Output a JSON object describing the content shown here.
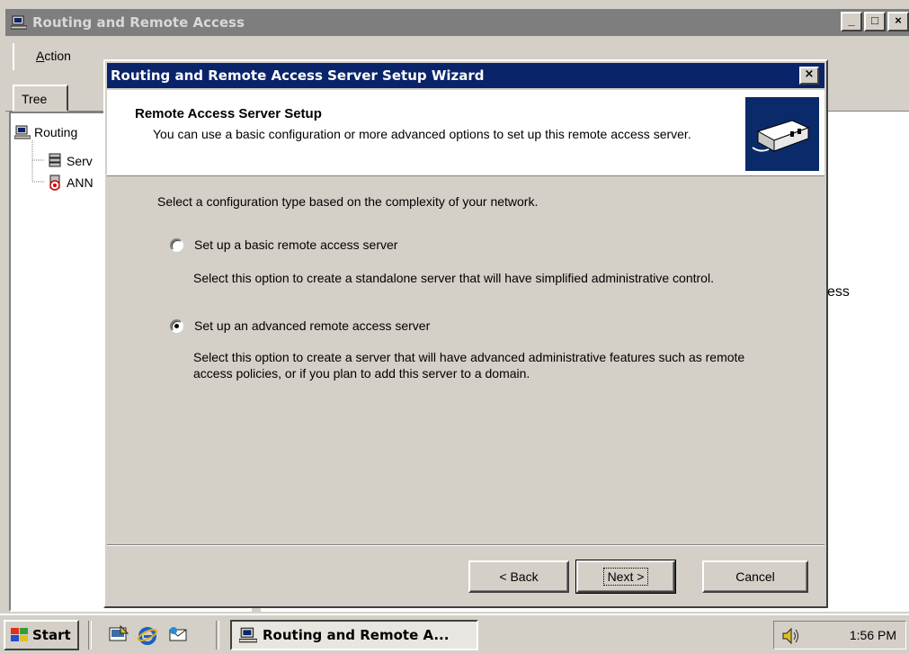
{
  "main_window": {
    "title": "Routing and Remote Access",
    "min_glyph": "_",
    "max_glyph": "□",
    "close_glyph": "×"
  },
  "menu": {
    "action_underlined": "A",
    "action_rest": "ction"
  },
  "tabs": {
    "tree": "Tree"
  },
  "tree": {
    "root": "Routing",
    "server_status": "Serv",
    "server_node": "ANN"
  },
  "right_pane": {
    "partial_text": "ess"
  },
  "wizard": {
    "title": "Routing and Remote Access Server Setup Wizard",
    "close_glyph": "×",
    "header_title": "Remote Access Server Setup",
    "header_desc": "You can use a basic configuration or more advanced options to set up this remote access server.",
    "prompt": "Select a configuration type based on the complexity of your network.",
    "options": [
      {
        "label": "Set up a basic remote access server",
        "desc": "Select this option to create a standalone server that will have simplified administrative control.",
        "selected": false
      },
      {
        "label": "Set up an advanced remote access server",
        "desc": "Select this option to create a server that will have advanced administrative features such as remote access policies, or if you plan to add this server to a domain.",
        "selected": true
      }
    ],
    "buttons": {
      "back": "< Back",
      "next": "Next >",
      "cancel": "Cancel"
    }
  },
  "taskbar": {
    "start": "Start",
    "task": "Routing and Remote A...",
    "clock": "1:56 PM"
  }
}
